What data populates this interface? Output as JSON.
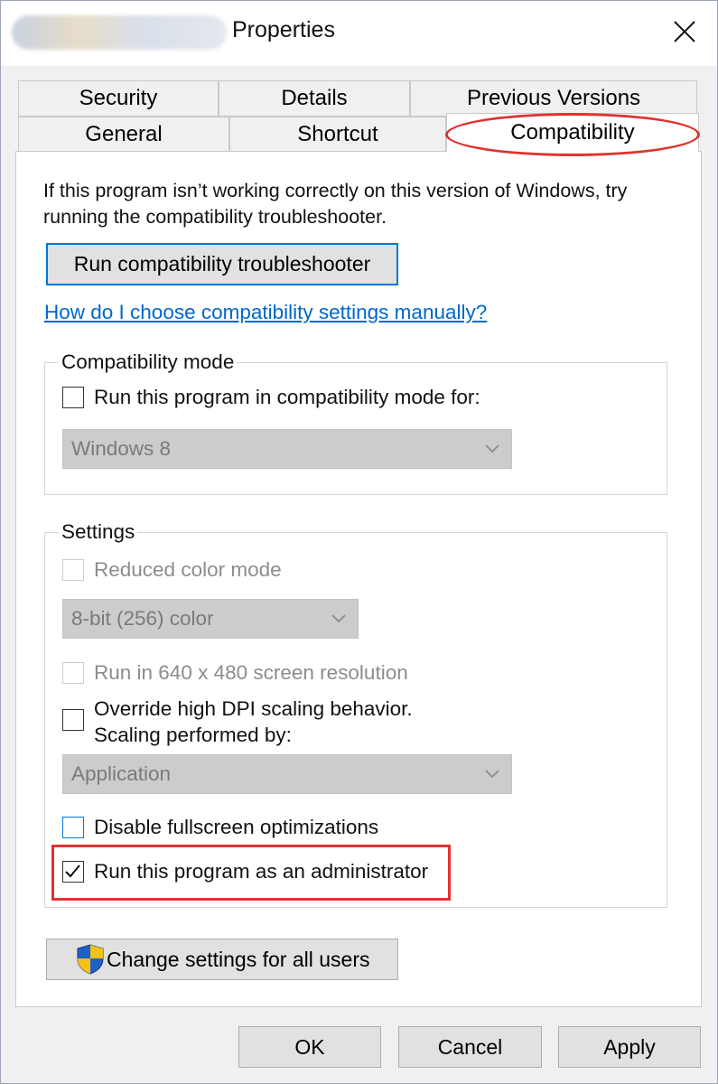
{
  "window": {
    "title": "Properties"
  },
  "tabs": {
    "row1": [
      "Security",
      "Details",
      "Previous Versions"
    ],
    "row2": [
      "General",
      "Shortcut",
      "Compatibility"
    ],
    "active": "Compatibility"
  },
  "description": "If this program isn’t working correctly on this version of Windows, try running the compatibility troubleshooter.",
  "troubleshooter_button": "Run compatibility troubleshooter",
  "help_link": "How do I choose compatibility settings manually?",
  "compat_mode": {
    "legend": "Compatibility mode",
    "checkbox_label": "Run this program in compatibility mode for:",
    "checked": false,
    "selected_os": "Windows 8"
  },
  "settings": {
    "legend": "Settings",
    "reduced_color": "Reduced color mode",
    "color_value": "8-bit (256) color",
    "resolution": "Run in 640 x 480 screen resolution",
    "dpi_line1": "Override high DPI scaling behavior.",
    "dpi_line2": "Scaling performed by:",
    "dpi_value": "Application",
    "fullscreen": "Disable fullscreen optimizations",
    "admin": "Run this program as an administrator",
    "admin_checked": true
  },
  "change_all_button": "Change settings for all users",
  "footer": {
    "ok": "OK",
    "cancel": "Cancel",
    "apply": "Apply"
  },
  "colors": {
    "accent": "#0078d7",
    "highlight": "#e0322e",
    "link": "#0066cc"
  }
}
